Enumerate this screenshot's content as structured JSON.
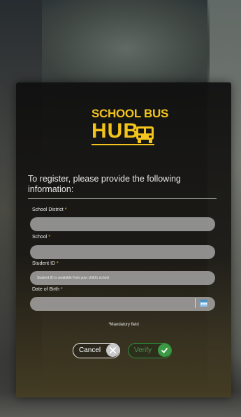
{
  "logo": {
    "line1": "SCHOOL BUS",
    "line2": "HUB",
    "brand_color": "#f2c41c"
  },
  "form": {
    "intro": "To register, please provide the following information:",
    "fields": [
      {
        "label": "School District",
        "required_mark": "*",
        "value": "",
        "placeholder": ""
      },
      {
        "label": "School",
        "required_mark": "*",
        "value": "",
        "placeholder": ""
      },
      {
        "label": "Student ID",
        "required_mark": "*",
        "value": "",
        "placeholder": "Student ID is available from your child's school"
      },
      {
        "label": "Date of Birth",
        "required_mark": "*",
        "value": "",
        "placeholder": "",
        "icon": "calendar-icon"
      }
    ],
    "mandatory_note": "*Mandatory field"
  },
  "buttons": {
    "cancel": {
      "label": "Cancel",
      "icon": "close-icon"
    },
    "verify": {
      "label": "Verify",
      "icon": "check-icon",
      "color": "#3c9a45"
    }
  }
}
